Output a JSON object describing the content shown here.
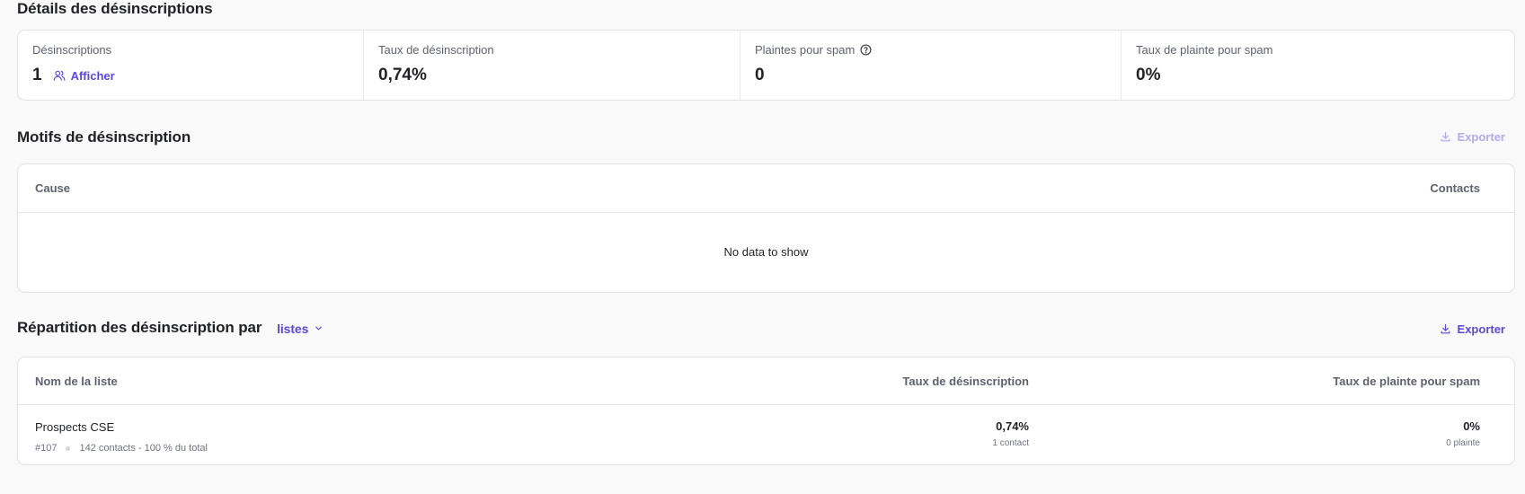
{
  "details": {
    "title": "Détails des désinscriptions",
    "stats": [
      {
        "label": "Désinscriptions",
        "value": "1",
        "link": "Afficher"
      },
      {
        "label": "Taux de désinscription",
        "value": "0,74%"
      },
      {
        "label": "Plaintes pour spam",
        "value": "0"
      },
      {
        "label": "Taux de plainte pour spam",
        "value": "0%"
      }
    ]
  },
  "reasons": {
    "title": "Motifs de désinscription",
    "export_label": "Exporter",
    "columns": {
      "cause": "Cause",
      "contacts": "Contacts"
    },
    "empty_text": "No data to show"
  },
  "distribution": {
    "title": "Répartition des désinscription par",
    "dropdown": "listes",
    "export_label": "Exporter",
    "columns": {
      "name": "Nom de la liste",
      "unsub_rate": "Taux de désinscription",
      "spam_rate": "Taux de plainte pour spam"
    },
    "rows": [
      {
        "name": "Prospects CSE",
        "id": "#107",
        "contacts": "142 contacts - 100 % du total",
        "unsub_rate": "0,74%",
        "unsub_sub": "1 contact",
        "spam_rate": "0%",
        "spam_sub": "0 plainte"
      }
    ]
  },
  "colors": {
    "accent": "#5b49d6",
    "accent_disabled": "#b3aaea",
    "background": "#f9f9f9"
  }
}
